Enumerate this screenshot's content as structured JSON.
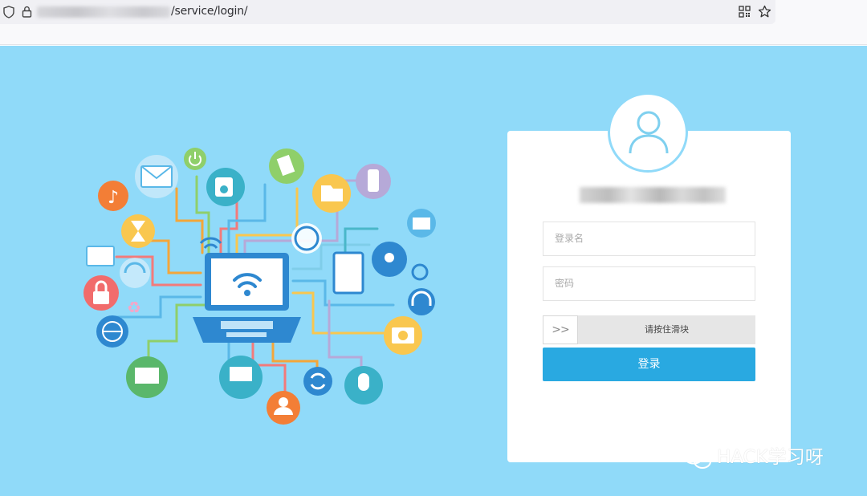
{
  "browser": {
    "url_path": "/service/login/",
    "icons": [
      "shield-icon",
      "lock-icon",
      "qr-code-icon",
      "bookmark-star-icon"
    ]
  },
  "page": {
    "background_color": "#90daf9",
    "illustration_icons": [
      "laptop-wifi-icon",
      "mail-icon",
      "power-icon",
      "camcorder-icon",
      "documents-icon",
      "folder-icon",
      "mobile-phone-icon",
      "envelope-icon",
      "music-note-icon",
      "hourglass-icon",
      "monitor-wifi-icon",
      "headset-chat-icon",
      "padlock-icon",
      "recycle-icon",
      "globe-icon",
      "tablet-wifi-icon",
      "antenna-icon",
      "gear-icon",
      "headphones-icon",
      "camera-icon",
      "sync-icon",
      "microphone-icon",
      "user-icon",
      "tv-wifi-icon"
    ]
  },
  "login": {
    "username_placeholder": "登录名",
    "password_placeholder": "密码",
    "slider_handle": ">>",
    "slider_text": "请按住滑块",
    "submit_label": "登录",
    "accent_color": "#29a9e1"
  },
  "watermark": {
    "text": "HACK学习呀"
  }
}
